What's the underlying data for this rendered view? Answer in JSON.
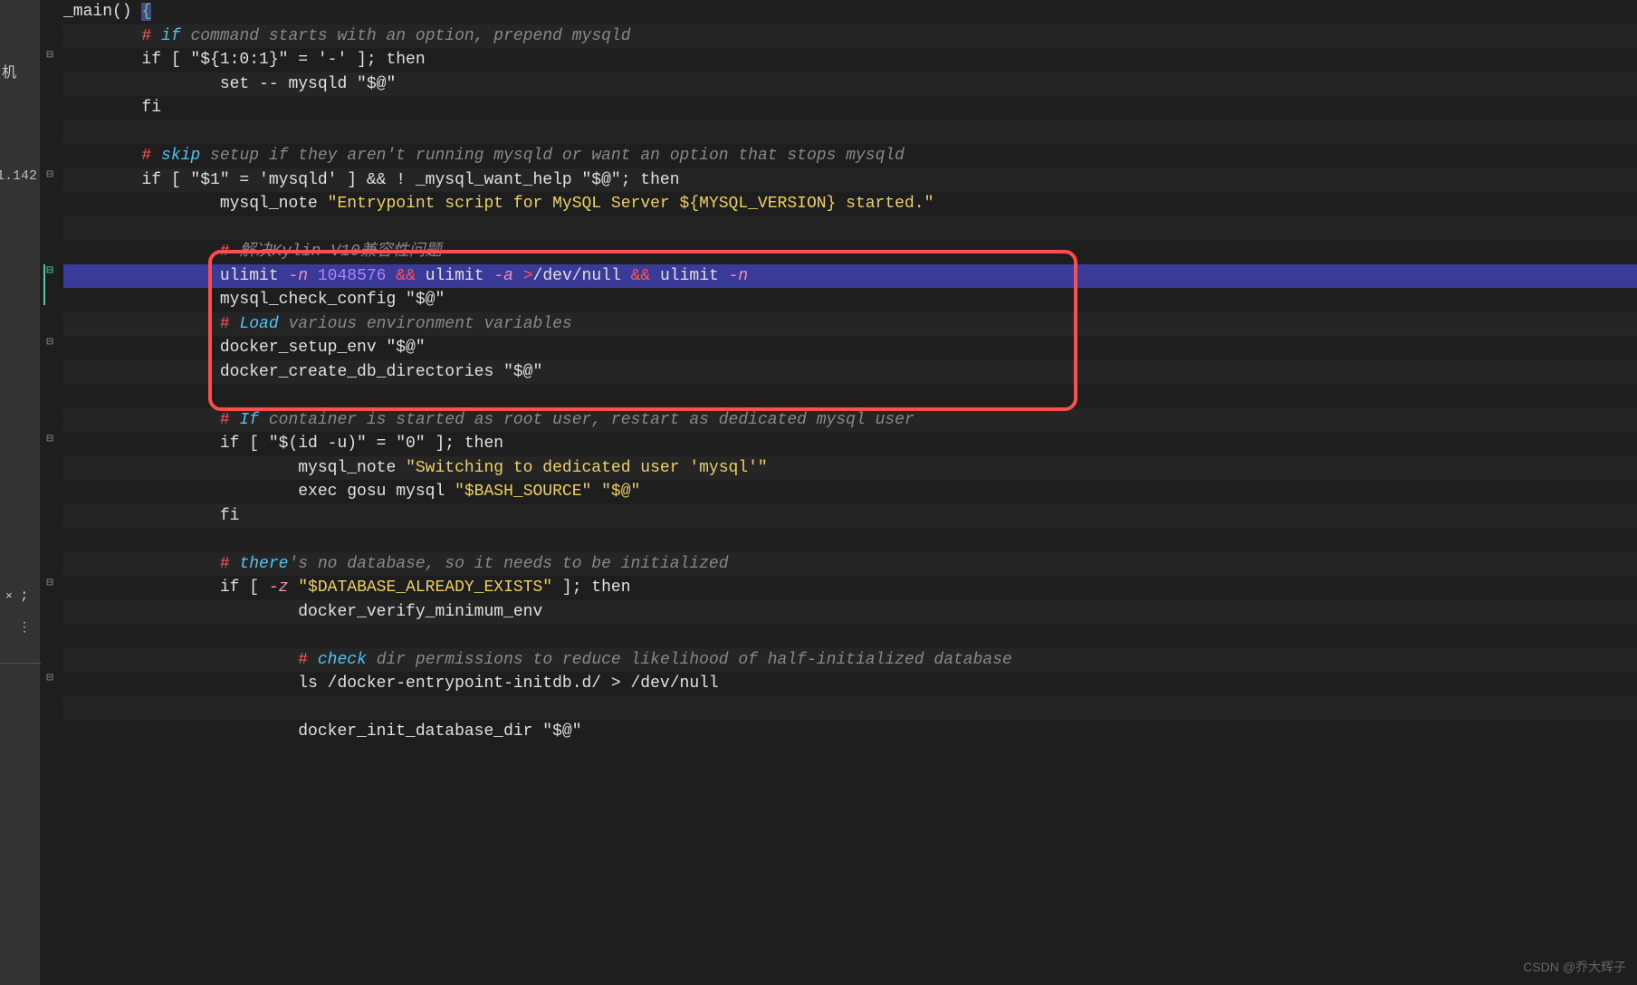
{
  "sidebar": {
    "label": "机",
    "ip": "1.142",
    "tab_marker": ";",
    "close_x": "×",
    "dots": "⋮",
    "bottom_marker": "-.."
  },
  "fold_markers": [
    "⊟",
    "⊟",
    "⊟",
    "⊟",
    "⊟",
    "⊟",
    "⊟"
  ],
  "code": {
    "l1_func": "_main() ",
    "l1_brace": "{",
    "l2_hash": "#",
    "l2_kw": " if ",
    "l2_txt": "command starts with an option, prepend mysqld",
    "l3": "        if [ \"${1:0:1}\" = '-' ]; then",
    "l4": "                set -- mysqld \"$@\"",
    "l5": "        fi",
    "l7_hash": "#",
    "l7_kw": " skip ",
    "l7_txt": "setup if they aren",
    "l7_txt2": "'t running mysqld or want an option that stops mysqld",
    "l8": "        if [ \"$1\" = 'mysqld' ] && ! _mysql_want_help \"$@\"; then",
    "l9_pre": "                mysql_note ",
    "l9_str": "\"Entrypoint script for MySQL Server ${MYSQL_VERSION} started.\"",
    "l11_hash": "# ",
    "l11_txt": "解决Kylin V10兼容性问题",
    "l12_ulimit": "                ulimit ",
    "l12_n": "-n",
    "l12_num": " 1048576",
    "l12_and": " && ",
    "l12_ulimit2": "ulimit ",
    "l12_a": "-a",
    "l12_op": " >",
    "l12_dev": "/dev/null",
    "l12_and2": " && ",
    "l12_ulimit3": "ulimit ",
    "l12_n2": "-n",
    "l13": "                mysql_check_config \"$@\"",
    "l14_hash": "#",
    "l14_kw": " Load ",
    "l14_txt": "various environment variables",
    "l15": "                docker_setup_env \"$@\"",
    "l16": "                docker_create_db_directories \"$@\"",
    "l18_hash": "#",
    "l18_kw": " If ",
    "l18_txt": "container is started as root user, restart as dedicated mysql user",
    "l19": "                if [ \"$(id -u)\" = \"0\" ]; then",
    "l20_pre": "                        mysql_note ",
    "l20_str": "\"Switching to dedicated user 'mysql'\"",
    "l21_pre": "                        exec gosu mysql ",
    "l21_str": "\"$BASH_SOURCE\" \"$@\"",
    "l22": "                fi",
    "l24_hash": "#",
    "l24_kw": " there",
    "l24_txt": "'s no database, so it needs to be initialized",
    "l25_pre": "                if [ ",
    "l25_z": "-z",
    "l25_str": " \"$DATABASE_ALREADY_EXISTS\" ",
    "l25_post": "]; then",
    "l26": "                        docker_verify_minimum_env",
    "l28_hash": "#",
    "l28_kw": " check ",
    "l28_txt": "dir permissions to reduce likelihood of half-initialized database",
    "l29": "                        ls /docker-entrypoint-initdb.d/ > /dev/null",
    "l31": "                        docker_init_database_dir \"$@\""
  },
  "watermark": "CSDN @乔大辉子"
}
